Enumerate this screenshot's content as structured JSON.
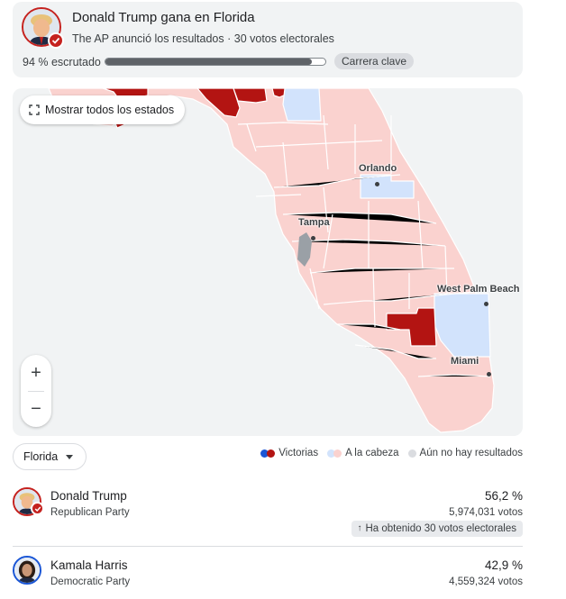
{
  "header": {
    "title": "Donald Trump gana en Florida",
    "subtitle": "The AP anunció los resultados · 30 votos electorales",
    "reported_label": "94 % escrutado",
    "reported_fraction": 0.94,
    "key_race_chip": "Carrera clave"
  },
  "map": {
    "show_all_button": "Mostrar todos los estados",
    "zoom_in": "+",
    "zoom_out": "−",
    "cities": [
      "Orlando",
      "Tampa",
      "West Palm Beach",
      "Miami"
    ]
  },
  "legend": {
    "state_select": "Florida",
    "victories": "Victorias",
    "leading": "A la cabeza",
    "no_results": "Aún no hay resultados"
  },
  "candidates": [
    {
      "name": "Donald Trump",
      "party": "Republican Party",
      "percent": "56,2 %",
      "votes": "5,974,031 votos",
      "electoral_chip": "Ha obtenido 30 votos electorales",
      "winner": true
    },
    {
      "name": "Kamala Harris",
      "party": "Democratic Party",
      "percent": "42,9 %",
      "votes": "4,559,324 votos"
    }
  ],
  "colors": {
    "rep_win": "#b31412",
    "rep_lead": "#fad2cf",
    "dem_win": "#1a56d6",
    "dem_lead": "#d2e3fc",
    "no_results": "#dadce0",
    "water": "#f1f3f4",
    "county_border": "#ffffff"
  }
}
